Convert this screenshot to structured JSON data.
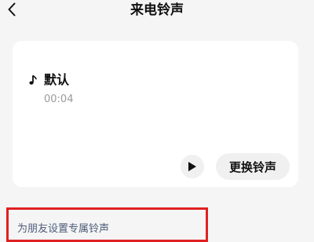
{
  "header": {
    "title": "来电铃声",
    "back_icon": "chevron-left-icon"
  },
  "current_ringtone": {
    "icon": "music-note-icon",
    "name": "默认",
    "duration": "00:04",
    "play_icon": "play-icon",
    "change_label": "更换铃声"
  },
  "friend_section": {
    "link_label": "为朋友设置专属铃声"
  },
  "colors": {
    "highlight": "#e02020",
    "link": "#4e5d7a",
    "muted": "#9a9a9a",
    "background": "#f5f5f5"
  }
}
